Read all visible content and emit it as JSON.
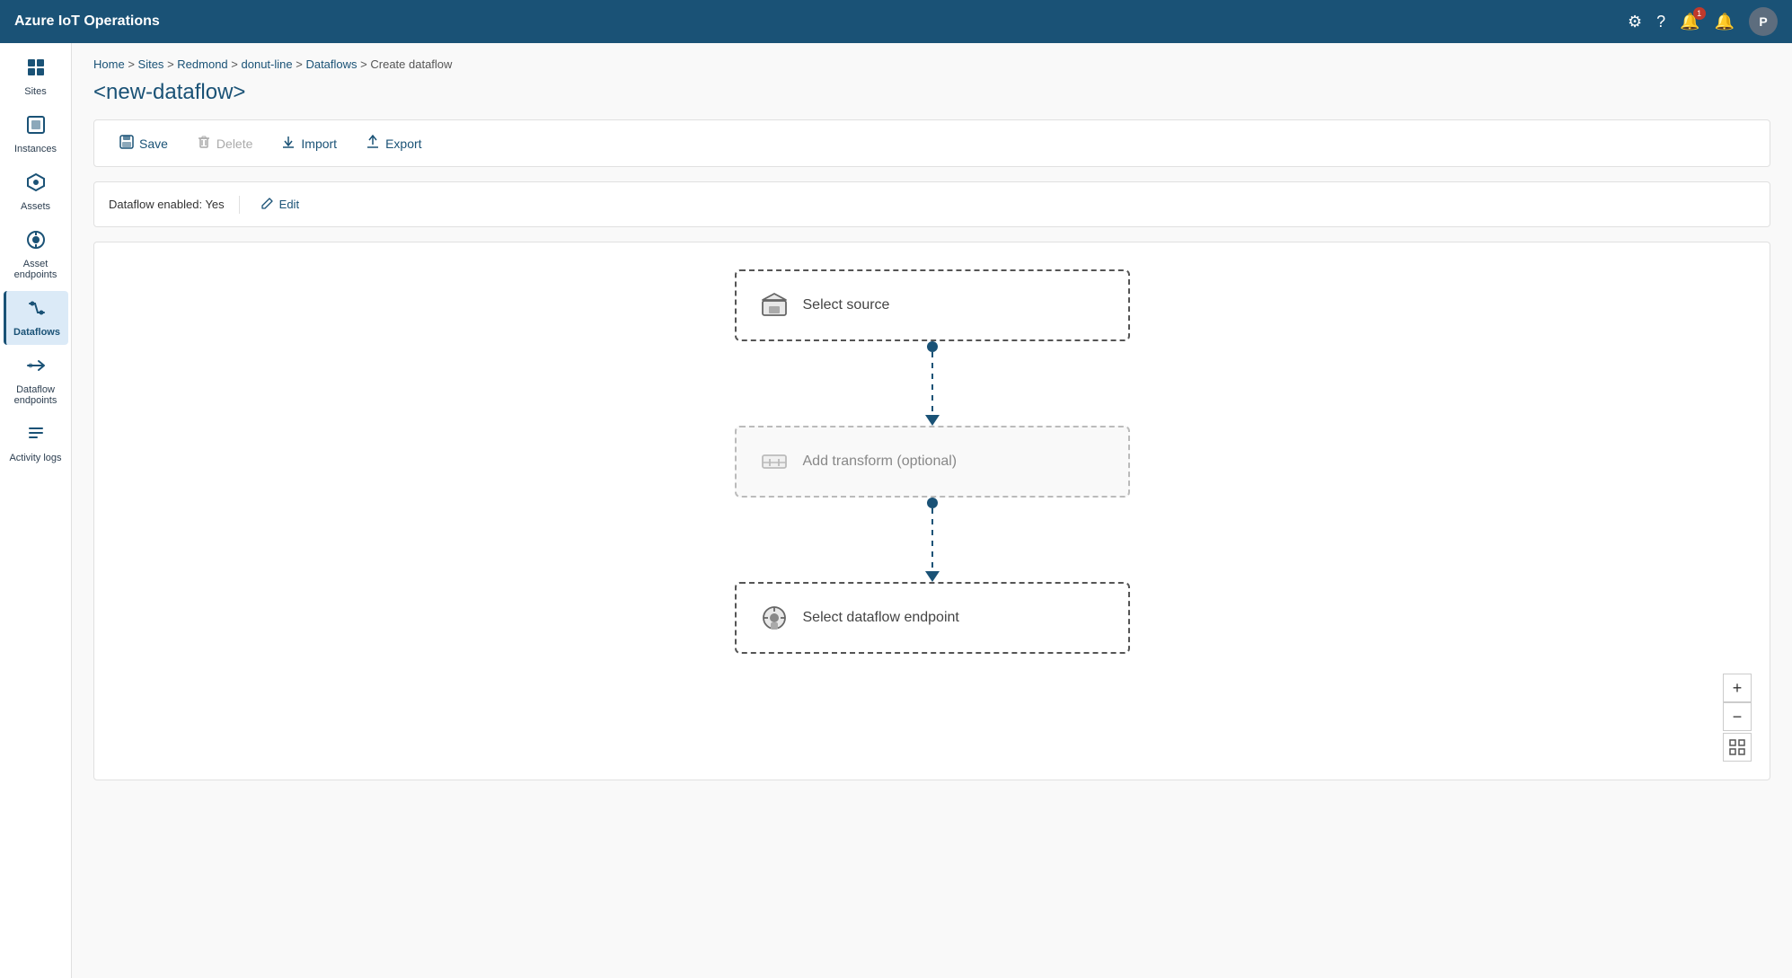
{
  "app": {
    "title": "Azure IoT Operations"
  },
  "topbar": {
    "title": "Azure IoT Operations",
    "icons": {
      "settings": "⚙",
      "help": "?",
      "notifications": "🔔",
      "alerts": "🔔",
      "avatar": "P"
    },
    "notification_count": "1"
  },
  "sidebar": {
    "items": [
      {
        "id": "sites",
        "label": "Sites",
        "icon": "⊞"
      },
      {
        "id": "instances",
        "label": "Instances",
        "icon": "◫"
      },
      {
        "id": "assets",
        "label": "Assets",
        "icon": "◈"
      },
      {
        "id": "asset-endpoints",
        "label": "Asset endpoints",
        "icon": "◉"
      },
      {
        "id": "dataflows",
        "label": "Dataflows",
        "icon": "⇄",
        "active": true
      },
      {
        "id": "dataflow-endpoints",
        "label": "Dataflow endpoints",
        "icon": "⇆"
      },
      {
        "id": "activity-logs",
        "label": "Activity logs",
        "icon": "≡"
      }
    ]
  },
  "breadcrumb": {
    "items": [
      "Home",
      "Sites",
      "Redmond",
      "donut-line",
      "Dataflows",
      "Create dataflow"
    ]
  },
  "page": {
    "title": "<new-dataflow>"
  },
  "toolbar": {
    "save_label": "Save",
    "delete_label": "Delete",
    "import_label": "Import",
    "export_label": "Export"
  },
  "status": {
    "text": "Dataflow enabled: Yes",
    "edit_label": "Edit"
  },
  "flow": {
    "source_node": {
      "label": "Select source",
      "icon": "📦"
    },
    "transform_node": {
      "label": "Add transform (optional)",
      "icon": "⊟"
    },
    "endpoint_node": {
      "label": "Select dataflow endpoint",
      "icon": "⚙"
    }
  },
  "zoom": {
    "plus": "+",
    "minus": "−",
    "fit": "⊞"
  }
}
